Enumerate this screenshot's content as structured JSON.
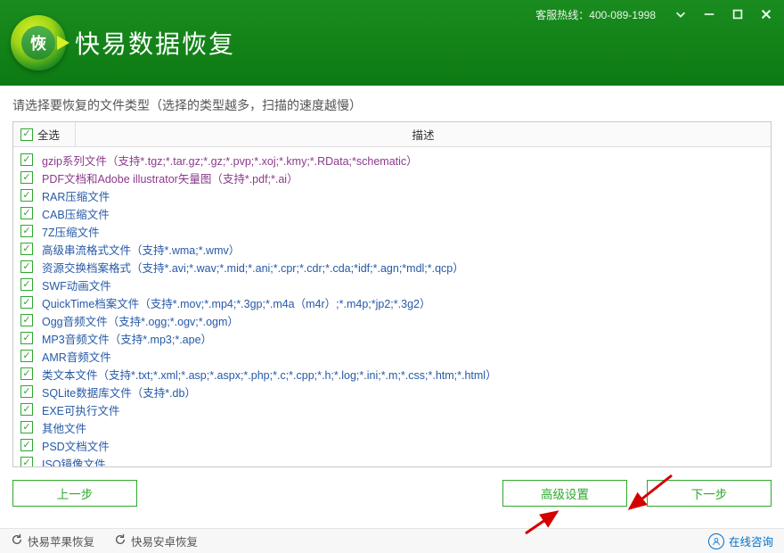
{
  "header": {
    "logo_char": "恢",
    "app_title": "快易数据恢复",
    "hotline_label": "客服热线：",
    "hotline_number": "400-089-1998"
  },
  "instruction": "请选择要恢复的文件类型（选择的类型越多，扫描的速度越慢）",
  "table": {
    "select_all": "全选",
    "desc_header": "描述"
  },
  "rows": [
    {
      "text": "gzip系列文件（支持*.tgz;*.tar.gz;*.gz;*.pvp;*.xoj;*.kmy;*.RData;*schematic）",
      "visited": true
    },
    {
      "text": "PDF文档和Adobe illustrator矢量图（支持*.pdf;*.ai）",
      "visited": true
    },
    {
      "text": "RAR压缩文件",
      "visited": false
    },
    {
      "text": "CAB压缩文件",
      "visited": false
    },
    {
      "text": "7Z压缩文件",
      "visited": false
    },
    {
      "text": "高级串流格式文件（支持*.wma;*.wmv）",
      "visited": false
    },
    {
      "text": "资源交换档案格式（支持*.avi;*.wav;*.mid;*.ani;*.cpr;*.cdr;*.cda;*idf;*.agn;*mdl;*.qcp）",
      "visited": false
    },
    {
      "text": "SWF动画文件",
      "visited": false
    },
    {
      "text": "QuickTime档案文件（支持*.mov;*.mp4;*.3gp;*.m4a（m4r）;*.m4p;*jp2;*.3g2）",
      "visited": false
    },
    {
      "text": "Ogg音频文件（支持*.ogg;*.ogv;*.ogm）",
      "visited": false
    },
    {
      "text": "MP3音频文件（支持*.mp3;*.ape）",
      "visited": false
    },
    {
      "text": "AMR音频文件",
      "visited": false
    },
    {
      "text": "类文本文件（支持*.txt;*.xml;*.asp;*.aspx;*.php;*.c;*.cpp;*.h;*.log;*.ini;*.m;*.css;*.htm;*.html）",
      "visited": false
    },
    {
      "text": "SQLite数据库文件（支持*.db）",
      "visited": false
    },
    {
      "text": "EXE可执行文件",
      "visited": false
    },
    {
      "text": "其他文件",
      "visited": false
    },
    {
      "text": "PSD文档文件",
      "visited": false
    },
    {
      "text": "ISO镜像文件",
      "visited": false
    }
  ],
  "buttons": {
    "prev": "上一步",
    "advanced": "高级设置",
    "next": "下一步"
  },
  "footer": {
    "apple": "快易苹果恢复",
    "android": "快易安卓恢复",
    "online": "在线咨询"
  }
}
